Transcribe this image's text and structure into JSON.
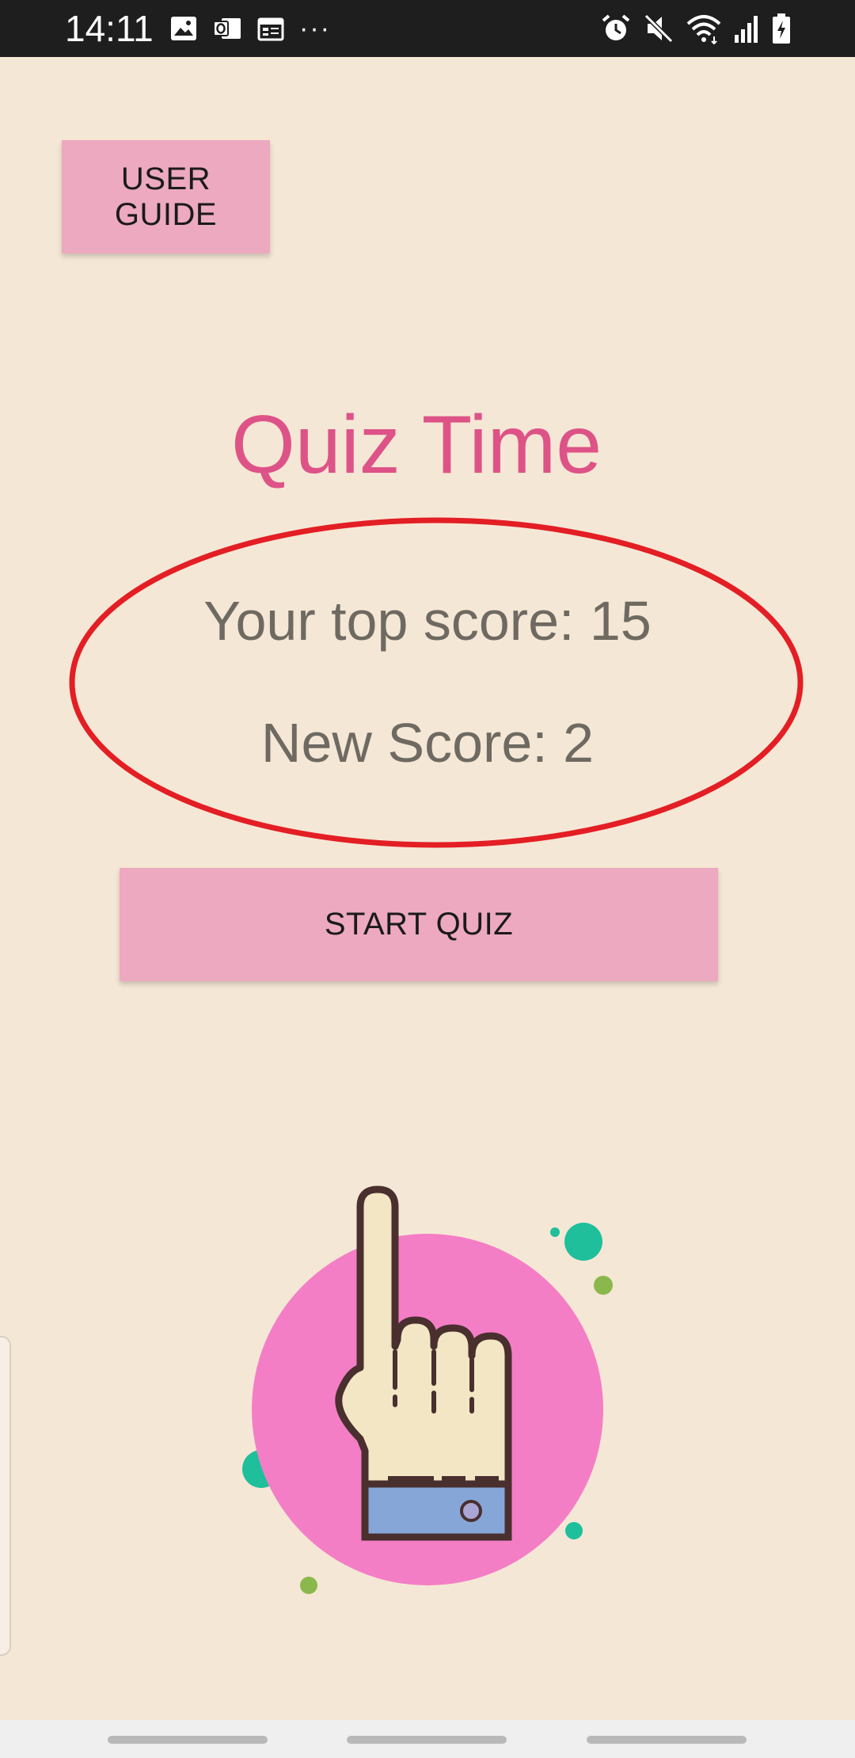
{
  "status_bar": {
    "time": "14:11",
    "left_icons": [
      "image-icon",
      "outlook-icon",
      "calendar-icon"
    ],
    "overflow": "···",
    "right_icons": [
      "alarm-icon",
      "mute-icon",
      "wifi-icon",
      "signal-icon",
      "battery-charging-icon"
    ]
  },
  "app": {
    "user_guide_label": "USER GUIDE",
    "title": "Quiz Time",
    "top_score_text": "Your top score: 15",
    "new_score_text": "New Score: 2",
    "start_quiz_label": "START QUIZ"
  },
  "colors": {
    "background": "#f5e7d5",
    "button": "#eca9bf",
    "title": "#de5387",
    "score_text": "#6e6a62",
    "annotation_ellipse": "#e31e24",
    "illustration_circle": "#f47ec6"
  },
  "illustration": {
    "icon": "pointing-hand-icon"
  }
}
